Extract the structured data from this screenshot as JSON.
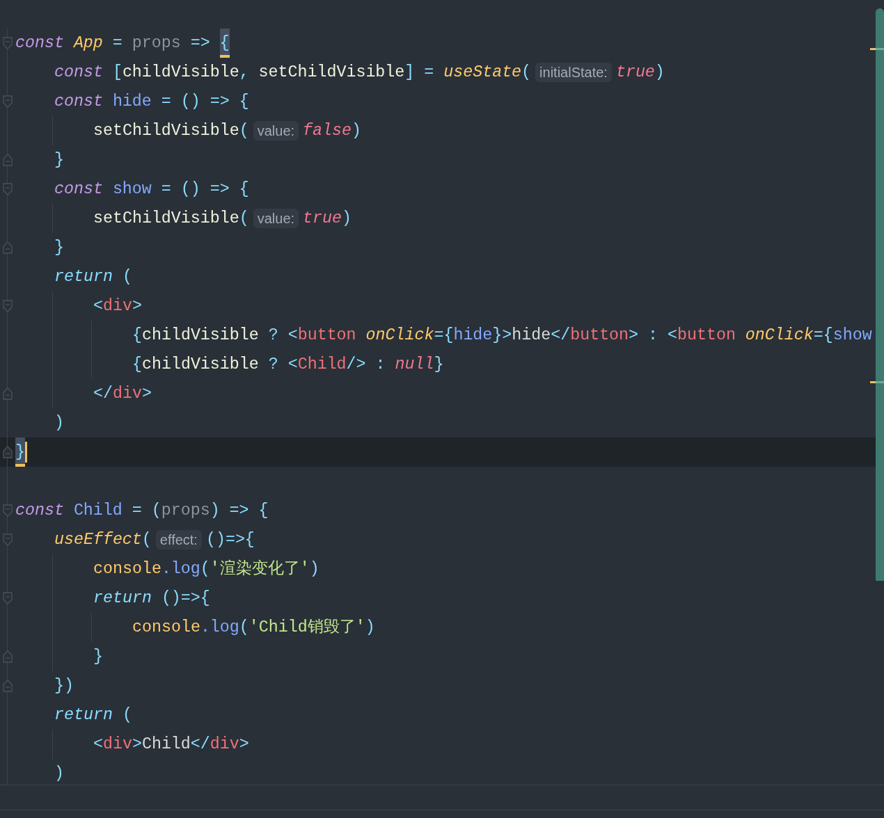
{
  "editor": {
    "lines": [
      {
        "collapse_start": true,
        "tokens": [
          {
            "text": "const ",
            "kind": "keyword"
          },
          {
            "text": "App",
            "kind": "component"
          },
          {
            "text": " = ",
            "kind": "operator"
          },
          {
            "text": "props",
            "kind": "parameter"
          },
          {
            "text": " => ",
            "kind": "operator"
          },
          {
            "text": "{",
            "kind": "operator",
            "matched": true
          }
        ],
        "children": [
          {
            "tokens": [
              {
                "text": "const ",
                "kind": "keyword"
              },
              {
                "text": "[",
                "kind": "operator"
              },
              {
                "text": "childVisible",
                "kind": "variable"
              },
              {
                "text": ", ",
                "kind": "operator"
              },
              {
                "text": "setChildVisible",
                "kind": "variable"
              },
              {
                "text": "] = ",
                "kind": "operator"
              },
              {
                "text": "useState",
                "kind": "call"
              },
              {
                "text": "(",
                "kind": "operator"
              },
              {
                "text": "initialState:",
                "kind": "hint"
              },
              {
                "text": "true",
                "kind": "literal"
              },
              {
                "text": ")",
                "kind": "operator"
              }
            ]
          },
          {
            "collapse_start": true,
            "tokens": [
              {
                "text": "const ",
                "kind": "keyword"
              },
              {
                "text": "hide",
                "kind": "function"
              },
              {
                "text": " = () => {",
                "kind": "operator"
              }
            ],
            "children": [
              {
                "tokens": [
                  {
                    "text": "setChildVisible",
                    "kind": "variable"
                  },
                  {
                    "text": "(",
                    "kind": "operator"
                  },
                  {
                    "text": "value:",
                    "kind": "hint"
                  },
                  {
                    "text": "false",
                    "kind": "literal"
                  },
                  {
                    "text": ")",
                    "kind": "operator"
                  }
                ]
              }
            ]
          },
          {
            "collapse_end": true,
            "tokens": [
              {
                "text": "}",
                "kind": "operator"
              }
            ]
          },
          {
            "collapse_start": true,
            "tokens": [
              {
                "text": "const ",
                "kind": "keyword"
              },
              {
                "text": "show",
                "kind": "function"
              },
              {
                "text": " = () => {",
                "kind": "operator"
              }
            ],
            "children": [
              {
                "tokens": [
                  {
                    "text": "setChildVisible",
                    "kind": "variable"
                  },
                  {
                    "text": "(",
                    "kind": "operator"
                  },
                  {
                    "text": "value:",
                    "kind": "hint"
                  },
                  {
                    "text": "true",
                    "kind": "literal"
                  },
                  {
                    "text": ")",
                    "kind": "operator"
                  }
                ]
              }
            ]
          },
          {
            "collapse_end": true,
            "tokens": [
              {
                "text": "}",
                "kind": "operator"
              }
            ]
          },
          {
            "tokens": [
              {
                "text": "return ",
                "kind": "return"
              },
              {
                "text": "(",
                "kind": "operator"
              }
            ],
            "children": [
              {
                "collapse_start": true,
                "tokens": [
                  {
                    "text": "<",
                    "kind": "operator"
                  },
                  {
                    "text": "div",
                    "kind": "tag"
                  },
                  {
                    "text": ">",
                    "kind": "operator"
                  }
                ],
                "children": [
                  {
                    "tokens": [
                      {
                        "text": "{",
                        "kind": "operator"
                      },
                      {
                        "text": "childVisible ",
                        "kind": "variable"
                      },
                      {
                        "text": "? <",
                        "kind": "operator"
                      },
                      {
                        "text": "button ",
                        "kind": "tag"
                      },
                      {
                        "text": "onClick",
                        "kind": "attribute"
                      },
                      {
                        "text": "={",
                        "kind": "operator"
                      },
                      {
                        "text": "hide",
                        "kind": "function"
                      },
                      {
                        "text": "}>",
                        "kind": "operator"
                      },
                      {
                        "text": "hide",
                        "kind": "text"
                      },
                      {
                        "text": "</",
                        "kind": "operator"
                      },
                      {
                        "text": "button",
                        "kind": "tag"
                      },
                      {
                        "text": "> : <",
                        "kind": "operator"
                      },
                      {
                        "text": "button ",
                        "kind": "tag"
                      },
                      {
                        "text": "onClick",
                        "kind": "attribute"
                      },
                      {
                        "text": "={",
                        "kind": "operator"
                      },
                      {
                        "text": "show",
                        "kind": "function"
                      }
                    ]
                  },
                  {
                    "tokens": [
                      {
                        "text": "{",
                        "kind": "operator"
                      },
                      {
                        "text": "childVisible ",
                        "kind": "variable"
                      },
                      {
                        "text": "? <",
                        "kind": "operator"
                      },
                      {
                        "text": "Child",
                        "kind": "tag"
                      },
                      {
                        "text": "/> : ",
                        "kind": "operator"
                      },
                      {
                        "text": "null",
                        "kind": "literal"
                      },
                      {
                        "text": "}",
                        "kind": "operator"
                      }
                    ]
                  }
                ]
              },
              {
                "collapse_end": true,
                "tokens": [
                  {
                    "text": "</",
                    "kind": "operator"
                  },
                  {
                    "text": "div",
                    "kind": "tag"
                  },
                  {
                    "text": ">",
                    "kind": "operator"
                  }
                ]
              }
            ]
          },
          {
            "tokens": [
              {
                "text": ")",
                "kind": "operator"
              }
            ]
          }
        ]
      },
      {
        "collapse_end": true,
        "current": true,
        "tokens": [
          {
            "text": "}",
            "kind": "operator",
            "matched": true
          }
        ]
      },
      {
        "collapse_start": true,
        "space_before": true,
        "tokens": [
          {
            "text": "const ",
            "kind": "keyword"
          },
          {
            "text": "Child",
            "kind": "function"
          },
          {
            "text": " = (",
            "kind": "operator"
          },
          {
            "text": "props",
            "kind": "parameter"
          },
          {
            "text": ") => {",
            "kind": "operator"
          }
        ],
        "children": [
          {
            "collapse_start": true,
            "tokens": [
              {
                "text": "useEffect",
                "kind": "call"
              },
              {
                "text": "(",
                "kind": "operator"
              },
              {
                "text": "effect:",
                "kind": "hint"
              },
              {
                "text": "()=>{",
                "kind": "operator"
              }
            ],
            "children": [
              {
                "tokens": [
                  {
                    "text": "console",
                    "kind": "object"
                  },
                  {
                    "text": ".log",
                    "kind": "function"
                  },
                  {
                    "text": "(",
                    "kind": "operator"
                  },
                  {
                    "text": "'渲染变化了'",
                    "kind": "string"
                  },
                  {
                    "text": ")",
                    "kind": "operator"
                  }
                ]
              },
              {
                "collapse_start": true,
                "tokens": [
                  {
                    "text": "return ",
                    "kind": "return"
                  },
                  {
                    "text": "()=>{",
                    "kind": "operator"
                  }
                ],
                "children": [
                  {
                    "tokens": [
                      {
                        "text": "console",
                        "kind": "object"
                      },
                      {
                        "text": ".log",
                        "kind": "function"
                      },
                      {
                        "text": "(",
                        "kind": "operator"
                      },
                      {
                        "text": "'Child销毁了'",
                        "kind": "string"
                      },
                      {
                        "text": ")",
                        "kind": "operator"
                      }
                    ]
                  }
                ]
              },
              {
                "collapse_end": true,
                "tokens": [
                  {
                    "text": "}",
                    "kind": "operator"
                  }
                ]
              }
            ]
          },
          {
            "collapse_end": true,
            "tokens": [
              {
                "text": "})",
                "kind": "operator"
              }
            ]
          },
          {
            "tokens": [
              {
                "text": "return ",
                "kind": "return"
              },
              {
                "text": "(",
                "kind": "operator"
              }
            ],
            "children": [
              {
                "tokens": [
                  {
                    "text": "<",
                    "kind": "operator"
                  },
                  {
                    "text": "div",
                    "kind": "tag"
                  },
                  {
                    "text": ">",
                    "kind": "operator"
                  },
                  {
                    "text": "Child",
                    "kind": "text"
                  },
                  {
                    "text": "</",
                    "kind": "operator"
                  },
                  {
                    "text": "div",
                    "kind": "tag"
                  },
                  {
                    "text": ">",
                    "kind": "operator"
                  }
                ]
              }
            ]
          },
          {
            "tokens": [
              {
                "text": ")",
                "kind": "operator"
              }
            ]
          }
        ]
      }
    ]
  }
}
